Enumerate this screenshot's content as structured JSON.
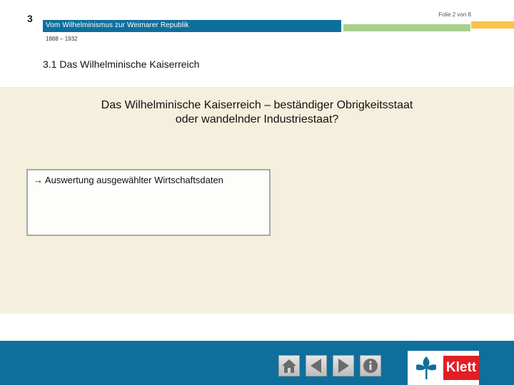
{
  "header": {
    "chapter_number": "3",
    "title": "Vom Wilhelminismus zur Weimarer Republik",
    "date_range": "1888 – 1932",
    "slide_counter": "Folie 2 von 8"
  },
  "section": {
    "heading": "3.1  Das Wilhelminische Kaiserreich"
  },
  "main": {
    "question_line1": "Das Wilhelminische Kaiserreich – beständiger Obrigkeitsstaat",
    "question_line2": "oder wandelnder Industriestaat?",
    "task": "→ Auswertung ausgewählter Wirtschaftsdaten"
  },
  "footer": {
    "logo_text": "Klett"
  },
  "colors": {
    "header_blue": "#0e6f9c",
    "green_accent": "#a8d08d",
    "yellow_accent": "#f7c44a",
    "content_bg": "#f5f0dd",
    "logo_red": "#e31e24"
  }
}
